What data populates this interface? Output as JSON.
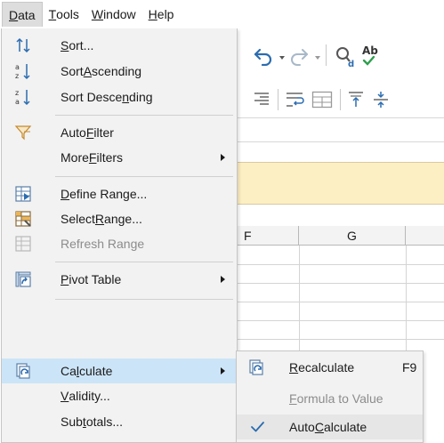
{
  "menubar": {
    "items": [
      {
        "pre": "",
        "u": "D",
        "post": "ata"
      },
      {
        "pre": "",
        "u": "T",
        "post": "ools"
      },
      {
        "pre": "",
        "u": "W",
        "post": "indow"
      },
      {
        "pre": "",
        "u": "H",
        "post": "elp"
      }
    ]
  },
  "sheet": {
    "columns": [
      "F",
      "G"
    ]
  },
  "data_menu": {
    "items": [
      {
        "pre": "",
        "u": "S",
        "post": "ort..."
      },
      {
        "pre": "Sort ",
        "u": "A",
        "post": "scending"
      },
      {
        "pre": "Sort Desce",
        "u": "n",
        "post": "ding"
      },
      {
        "pre": "Auto",
        "u": "F",
        "post": "ilter"
      },
      {
        "pre": "More ",
        "u": "F",
        "post": "ilters"
      },
      {
        "pre": "",
        "u": "D",
        "post": "efine Range..."
      },
      {
        "pre": "Select ",
        "u": "R",
        "post": "ange..."
      },
      {
        "pre": "Refresh Range",
        "u": "",
        "post": ""
      },
      {
        "pre": "",
        "u": "P",
        "post": "ivot Table"
      },
      {
        "pre": "Ca",
        "u": "l",
        "post": "culate"
      },
      {
        "pre": "",
        "u": "V",
        "post": "alidity..."
      },
      {
        "pre": "Sub",
        "u": "t",
        "post": "otals..."
      }
    ]
  },
  "calculate_submenu": {
    "items": [
      {
        "pre": "",
        "u": "R",
        "post": "ecalculate",
        "shortcut": "F9"
      },
      {
        "pre": "",
        "u": "F",
        "post": "ormula to Value",
        "shortcut": ""
      },
      {
        "pre": "Auto",
        "u": "C",
        "post": "alculate",
        "shortcut": ""
      }
    ]
  },
  "colors": {
    "menu_bg": "#f2f2f2",
    "highlight": "#cce4f7",
    "infobar": "#fdefc4",
    "icon_blue": "#2b6cb0",
    "disabled_text": "#8c8c8c"
  }
}
